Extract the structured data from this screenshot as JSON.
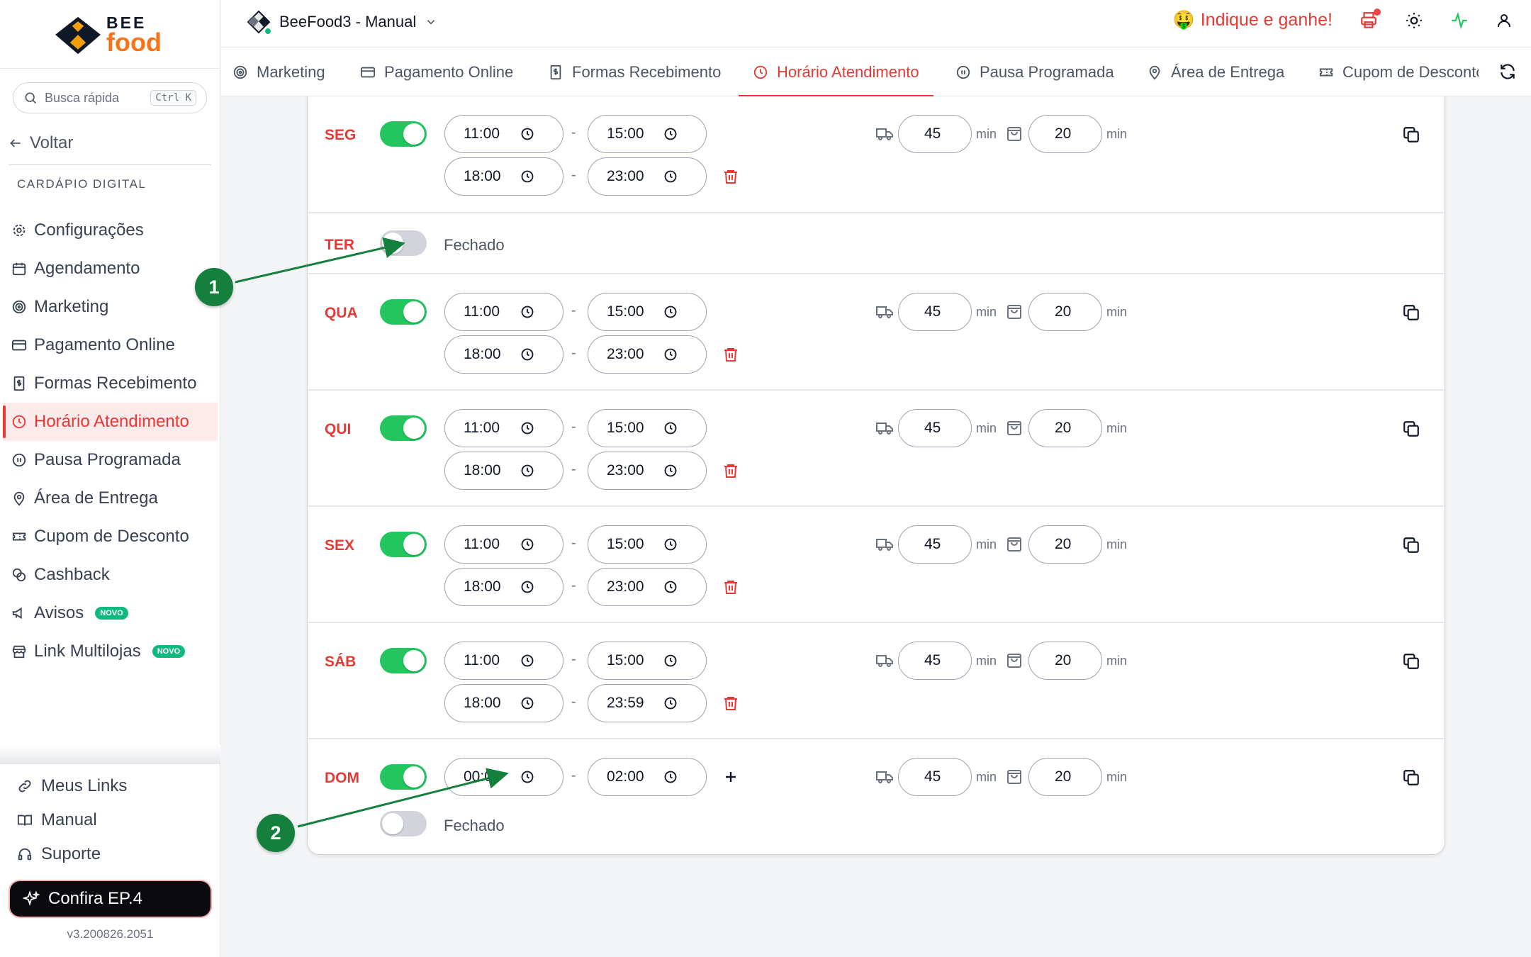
{
  "sidebar": {
    "logo": {
      "line1": "BEE",
      "line2": "food"
    },
    "search": {
      "placeholder": "Busca rápida",
      "shortcut": "Ctrl K"
    },
    "back_label": "Voltar",
    "section_label": "CARDÁPIO DIGITAL",
    "menu": [
      {
        "label": "Configurações",
        "icon": "gear-icon"
      },
      {
        "label": "Agendamento",
        "icon": "calendar-icon"
      },
      {
        "label": "Marketing",
        "icon": "target-icon"
      },
      {
        "label": "Pagamento Online",
        "icon": "card-icon"
      },
      {
        "label": "Formas Recebimento",
        "icon": "receipt-icon"
      },
      {
        "label": "Horário Atendimento",
        "icon": "clock-icon",
        "active": true
      },
      {
        "label": "Pausa Programada",
        "icon": "pause-icon"
      },
      {
        "label": "Área de Entrega",
        "icon": "map-pin-icon"
      },
      {
        "label": "Cupom de Desconto",
        "icon": "ticket-icon"
      },
      {
        "label": "Cashback",
        "icon": "coins-icon"
      },
      {
        "label": "Avisos",
        "icon": "megaphone-icon",
        "badge": "NOVO"
      },
      {
        "label": "Link Multilojas",
        "icon": "store-icon",
        "badge": "NOVO"
      }
    ],
    "bottom": [
      {
        "label": "Meus Links",
        "icon": "link-icon"
      },
      {
        "label": "Manual",
        "icon": "book-icon"
      },
      {
        "label": "Suporte",
        "icon": "headset-icon"
      }
    ],
    "promo_button": "Confira EP.4",
    "version": "v3.200826.2051"
  },
  "header": {
    "store_name": "BeeFood3 - Manual",
    "referral": "Indique e ganhe!",
    "referral_emoji": "🤑"
  },
  "tabs": [
    {
      "label": "Marketing",
      "icon": "target-icon"
    },
    {
      "label": "Pagamento Online",
      "icon": "card-icon"
    },
    {
      "label": "Formas Recebimento",
      "icon": "receipt-icon"
    },
    {
      "label": "Horário Atendimento",
      "icon": "clock-icon",
      "active": true
    },
    {
      "label": "Pausa Programada",
      "icon": "pause-icon"
    },
    {
      "label": "Área de Entrega",
      "icon": "map-pin-icon"
    },
    {
      "label": "Cupom de Desconto",
      "icon": "ticket-icon"
    }
  ],
  "schedule": {
    "unit": "min",
    "closed_label": "Fechado",
    "days": [
      {
        "day": "SEG",
        "open": true,
        "slots": [
          [
            "11:00",
            "15:00"
          ],
          [
            "18:00",
            "23:00"
          ]
        ],
        "delivery": "45",
        "pickup": "20"
      },
      {
        "day": "TER",
        "open": false
      },
      {
        "day": "QUA",
        "open": true,
        "slots": [
          [
            "11:00",
            "15:00"
          ],
          [
            "18:00",
            "23:00"
          ]
        ],
        "delivery": "45",
        "pickup": "20"
      },
      {
        "day": "QUI",
        "open": true,
        "slots": [
          [
            "11:00",
            "15:00"
          ],
          [
            "18:00",
            "23:00"
          ]
        ],
        "delivery": "45",
        "pickup": "20"
      },
      {
        "day": "SEX",
        "open": true,
        "slots": [
          [
            "11:00",
            "15:00"
          ],
          [
            "18:00",
            "23:00"
          ]
        ],
        "delivery": "45",
        "pickup": "20"
      },
      {
        "day": "SÁB",
        "open": true,
        "slots": [
          [
            "11:00",
            "15:00"
          ],
          [
            "18:00",
            "23:59"
          ]
        ],
        "delivery": "45",
        "pickup": "20"
      },
      {
        "day": "DOM",
        "open": true,
        "slots": [
          [
            "00:00",
            "02:00"
          ]
        ],
        "delivery": "45",
        "pickup": "20",
        "second_open": false
      }
    ]
  },
  "annotations": [
    "1",
    "2"
  ],
  "colors": {
    "accent": "#e53935",
    "toggle_on": "#22c55e",
    "marker": "#15803d",
    "brand_orange": "#f97316"
  }
}
